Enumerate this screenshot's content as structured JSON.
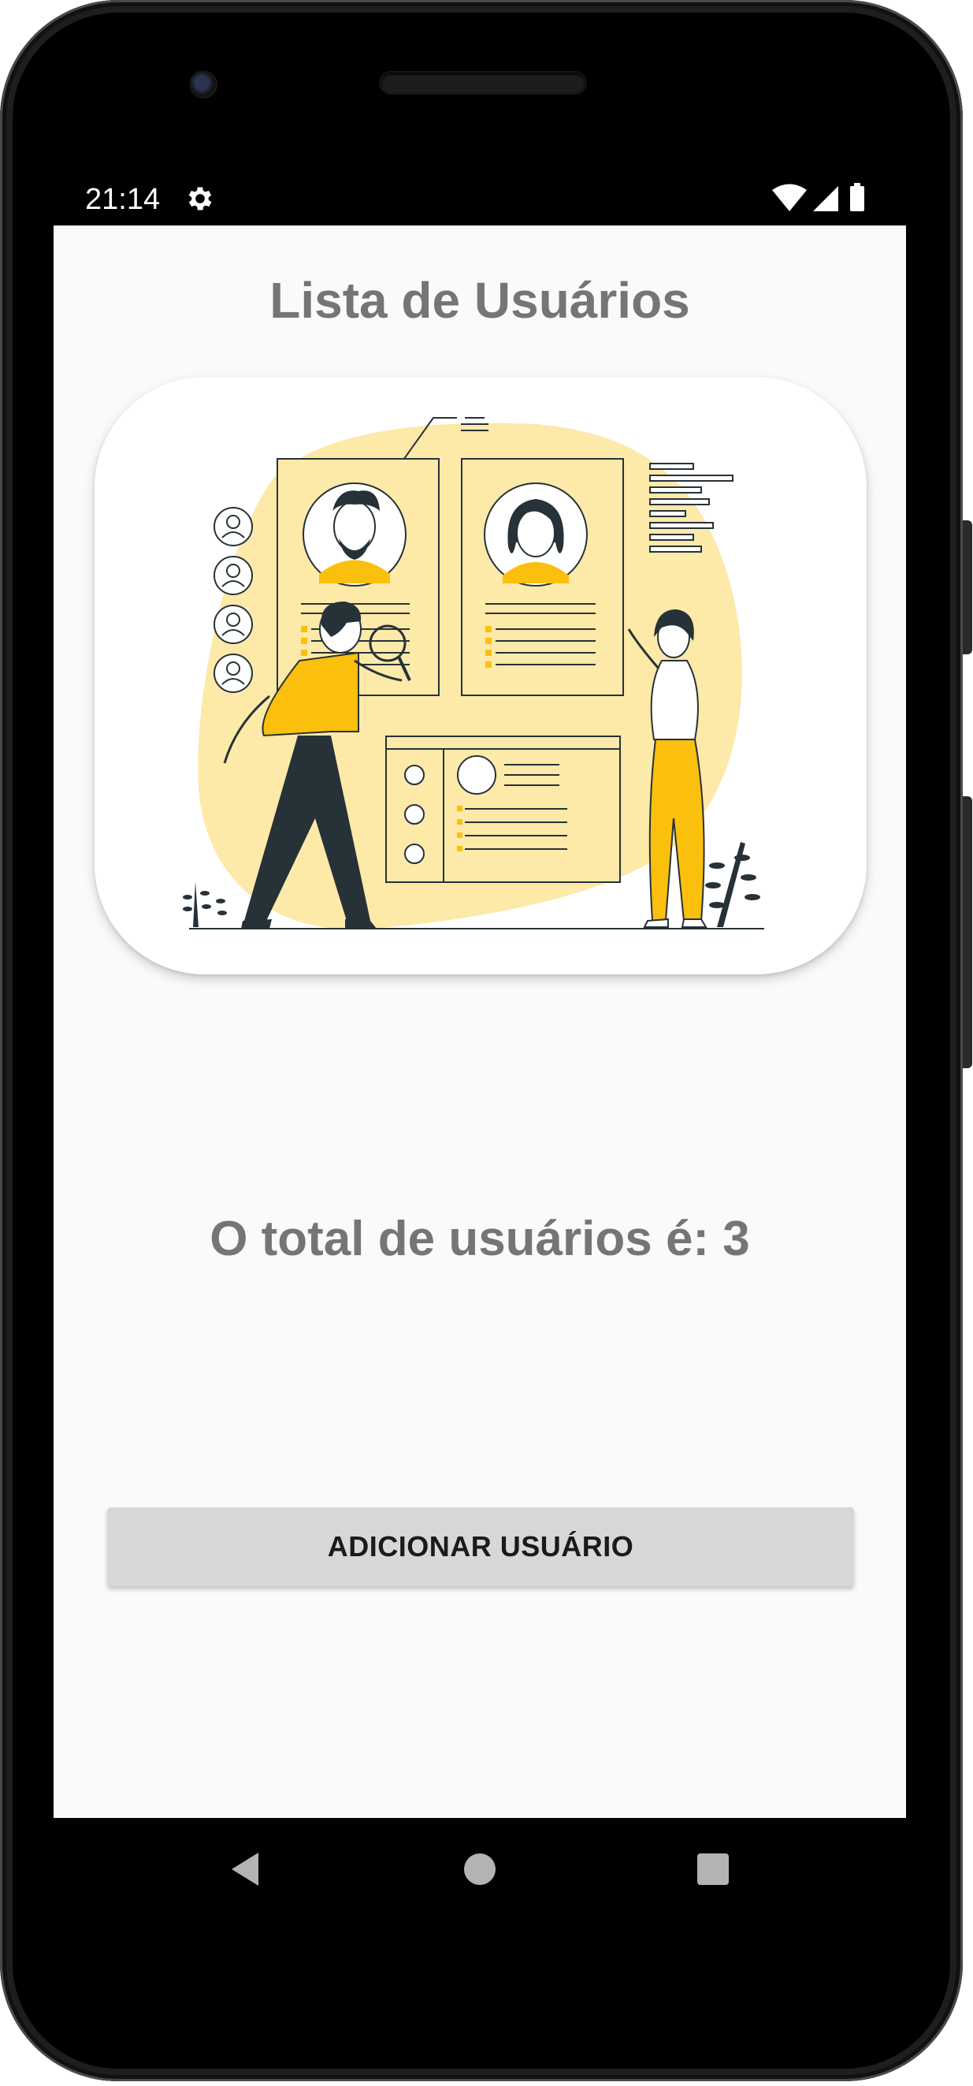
{
  "status_bar": {
    "time": "21:14",
    "icons": [
      "gear-icon",
      "wifi-icon",
      "signal-icon",
      "battery-icon"
    ]
  },
  "screen": {
    "title": "Lista de Usuários",
    "total_text": "O total de usuários é: 3",
    "add_button_label": "ADICIONAR USUÁRIO"
  },
  "nav_bar": {
    "buttons": [
      "back-icon",
      "home-icon",
      "recents-icon"
    ]
  },
  "colors": {
    "screen_background": "#fafafa",
    "text_gray": "#757575",
    "button_background": "#d6d7d7",
    "illustration_accent": "#fbbf0d",
    "illustration_blob": "#fde9a8",
    "illustration_dark": "#263238"
  }
}
